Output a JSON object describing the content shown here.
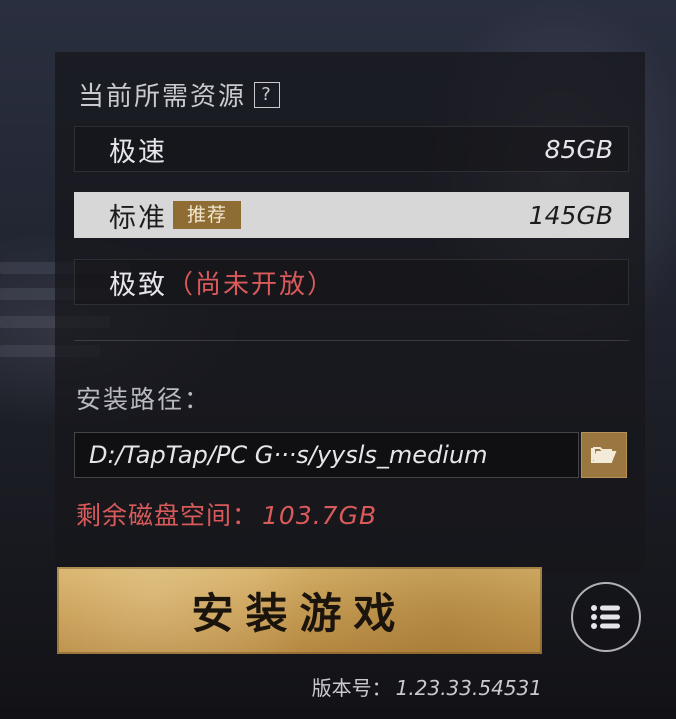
{
  "resources": {
    "title": "当前所需资源",
    "help_icon": "?",
    "options": [
      {
        "name": "极速",
        "size": "85GB",
        "selected": false
      },
      {
        "name": "标准",
        "badge": "推荐",
        "size": "145GB",
        "selected": true
      },
      {
        "name": "极致",
        "status": "（尚未开放）",
        "selected": false
      }
    ]
  },
  "install_path": {
    "label": "安装路径：",
    "value": "D:/TapTap/PC G···s/yysls_medium"
  },
  "disk": {
    "label": "剩余磁盘空间：",
    "value": "103.7GB"
  },
  "install_button": {
    "label": "安装游戏"
  },
  "version": {
    "label": "版本号：",
    "number": "1.23.33.54531"
  },
  "icons": {
    "help": "question-mark-icon",
    "folder": "open-folder-icon",
    "menu": "list-menu-icon"
  },
  "colors": {
    "accent_gold": "#9a7740",
    "warning_red": "#d95a5a",
    "selected_bg": "#d7d7d7"
  }
}
